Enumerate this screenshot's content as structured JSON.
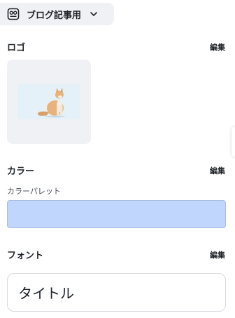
{
  "kit": {
    "name": "ブログ記事用",
    "icon": "brand-kit-icon",
    "chevron_icon": "chevron-down-icon"
  },
  "logo_section": {
    "title": "ロゴ",
    "edit_label": "編集",
    "image_icon": "cat-logo-image"
  },
  "color_section": {
    "title": "カラー",
    "edit_label": "編集",
    "palette_label": "カラーパレット",
    "palette_colors": [
      "#c0d6fd"
    ]
  },
  "font_section": {
    "title": "フォント",
    "edit_label": "編集",
    "sample_text": "タイトル"
  }
}
